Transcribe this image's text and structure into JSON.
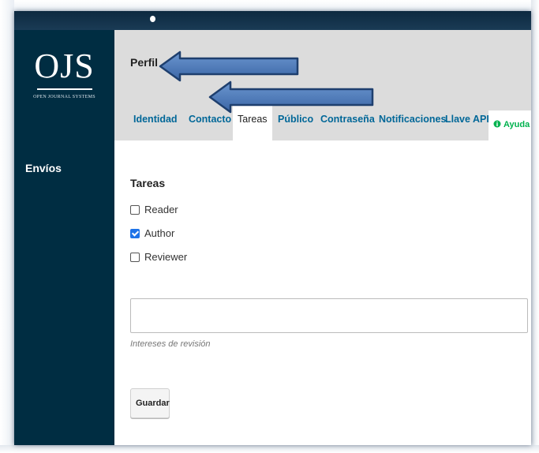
{
  "logo": {
    "main": "OJS",
    "sub": "OPEN JOURNAL SYSTEMS"
  },
  "sidebar": {
    "items": [
      {
        "label": "Envíos"
      }
    ]
  },
  "header": {
    "title": "Perfil"
  },
  "tabs": [
    {
      "label": "Identidad",
      "active": false
    },
    {
      "label": "Contacto",
      "active": false
    },
    {
      "label": "Tareas",
      "active": true
    },
    {
      "label": "Público",
      "active": false
    },
    {
      "label": "Contraseña",
      "active": false
    },
    {
      "label": "Notificaciones",
      "active": false
    },
    {
      "label": "Llave API",
      "active": false
    }
  ],
  "help": {
    "icon": "info-circle-icon",
    "label": "Ayuda",
    "color": "#00b24e"
  },
  "roles": {
    "title": "Tareas",
    "items": [
      {
        "label": "Reader",
        "checked": false
      },
      {
        "label": "Author",
        "checked": true
      },
      {
        "label": "Reviewer",
        "checked": false
      }
    ]
  },
  "interests": {
    "value": "",
    "label": "Intereses de revisión"
  },
  "save_button": {
    "label": "Guardar"
  },
  "colors": {
    "sidebar": "#002d42",
    "link": "#006798",
    "header_bg": "#dcdcdc",
    "arrow": "#4a78b8",
    "checkbox_checked": "#1e73e8"
  }
}
